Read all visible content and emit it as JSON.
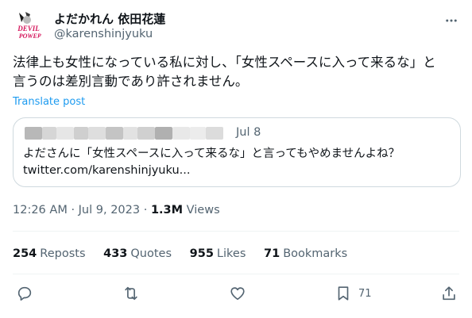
{
  "author": {
    "display_name": "よだかれん 依田花蓮",
    "handle": "@karenshinjyuku",
    "avatar_text_top": "DEVIL",
    "avatar_text_bottom": "POWER"
  },
  "tweet": {
    "text_line1": "法律上も女性になっている私に対し、「女性スペースに入って来るな」と",
    "text_line2": "言うのは差別言動であり許されません。",
    "translate_label": "Translate post"
  },
  "quoted": {
    "date": "Jul 8",
    "text_line1": "よださんに「女性スペースに入って来るな」と言ってもやめませんよね？",
    "text_line2": "twitter.com/karenshinjyuku..."
  },
  "meta": {
    "time": "12:26 AM",
    "separator1": "·",
    "date": "Jul 9, 2023",
    "separator2": "·",
    "views_count": "1.3M",
    "views_label": "Views"
  },
  "stats": {
    "reposts_count": "254",
    "reposts_label": "Reposts",
    "quotes_count": "433",
    "quotes_label": "Quotes",
    "likes_count": "955",
    "likes_label": "Likes",
    "bookmarks_count": "71",
    "bookmarks_label": "Bookmarks"
  },
  "actions": {
    "bookmark_count": "71"
  },
  "colors": {
    "text_primary": "#0f1419",
    "text_secondary": "#536471",
    "link": "#1d9bf0",
    "border": "#cfd9de",
    "divider": "#eff3f4"
  },
  "icons": [
    "more-icon",
    "reply-icon",
    "repost-icon",
    "like-icon",
    "bookmark-icon",
    "share-icon"
  ]
}
